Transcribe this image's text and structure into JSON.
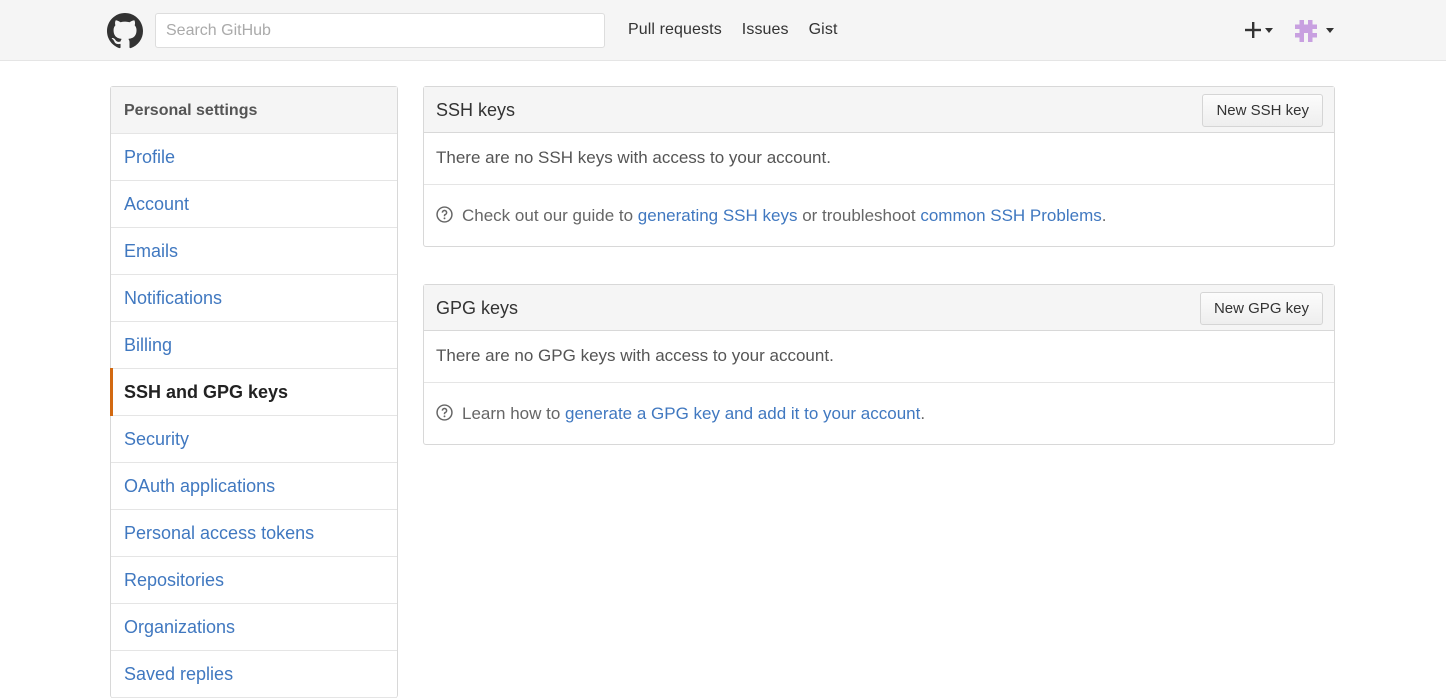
{
  "header": {
    "logo_icon": "github-octocat-icon",
    "search_placeholder": "Search GitHub",
    "nav": [
      "Pull requests",
      "Issues",
      "Gist"
    ],
    "create_icon": "plus-icon",
    "avatar_icon": "user-avatar-icon"
  },
  "sidebar": {
    "heading": "Personal settings",
    "items": [
      {
        "label": "Profile",
        "selected": false
      },
      {
        "label": "Account",
        "selected": false
      },
      {
        "label": "Emails",
        "selected": false
      },
      {
        "label": "Notifications",
        "selected": false
      },
      {
        "label": "Billing",
        "selected": false
      },
      {
        "label": "SSH and GPG keys",
        "selected": true
      },
      {
        "label": "Security",
        "selected": false
      },
      {
        "label": "OAuth applications",
        "selected": false
      },
      {
        "label": "Personal access tokens",
        "selected": false
      },
      {
        "label": "Repositories",
        "selected": false
      },
      {
        "label": "Organizations",
        "selected": false
      },
      {
        "label": "Saved replies",
        "selected": false
      }
    ],
    "accent_color": "#d26911"
  },
  "ssh": {
    "title": "SSH keys",
    "button": "New SSH key",
    "empty_text": "There are no SSH keys with access to your account.",
    "help_prefix": "Check out our guide to ",
    "help_link1": "generating SSH keys",
    "help_middle": " or troubleshoot ",
    "help_link2": "common SSH Problems",
    "help_suffix": "."
  },
  "gpg": {
    "title": "GPG keys",
    "button": "New GPG key",
    "empty_text": "There are no GPG keys with access to your account.",
    "help_prefix": "Learn how to ",
    "help_link": "generate a GPG key and add it to your account",
    "help_suffix": "."
  },
  "colors": {
    "link": "#4078c0",
    "header_bg": "#f5f5f5"
  }
}
